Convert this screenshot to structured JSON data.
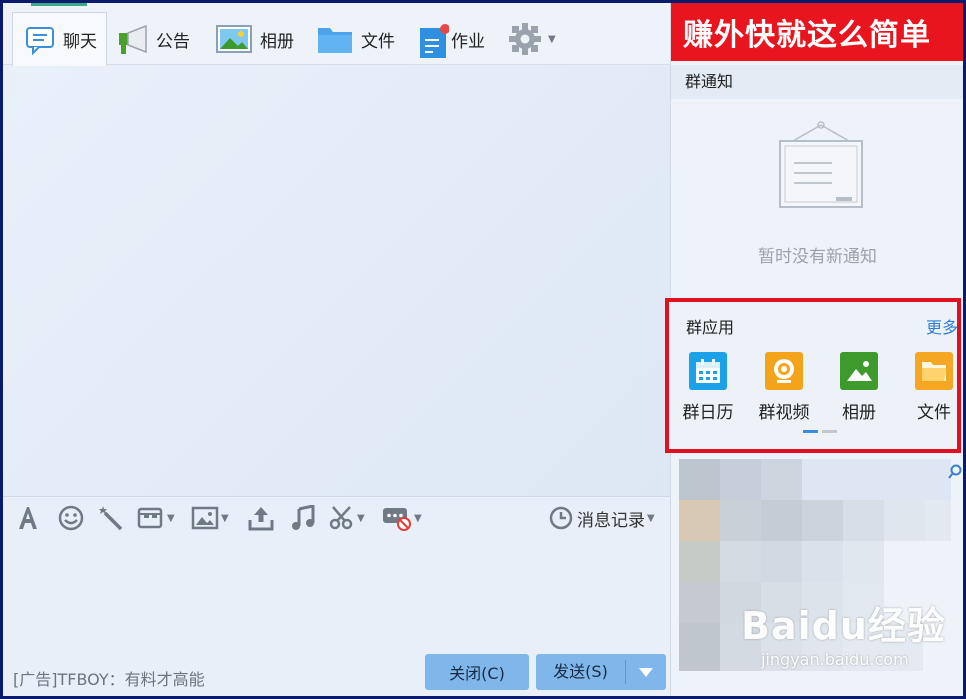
{
  "tabs": {
    "chat": "聊天",
    "notice": "公告",
    "album": "相册",
    "file": "文件",
    "homework": "作业"
  },
  "toolbar": {
    "history_label": "消息记录"
  },
  "footer": {
    "ad_text": "[广告]TFBOY：有料才高能",
    "close_label": "关闭(C)",
    "send_label": "发送(S)"
  },
  "right_panel": {
    "banner_text": "赚外快就这么简单",
    "notice_title": "群通知",
    "no_notice_text": "暂时没有新通知",
    "apps_title": "群应用",
    "apps_more": "更多",
    "apps": [
      {
        "label": "群日历",
        "icon": "calendar-icon",
        "color": "#1ba1e8"
      },
      {
        "label": "群视频",
        "icon": "video-icon",
        "color": "#f3a41b"
      },
      {
        "label": "相册",
        "icon": "album-icon",
        "color": "#3f9a2e"
      },
      {
        "label": "文件",
        "icon": "folder-icon",
        "color": "#f5a623"
      }
    ]
  },
  "watermark": {
    "main": "Baidu经验",
    "sub": "jingyan.baidu.com"
  },
  "colors": {
    "accent": "#7fb7ea",
    "banner": "#e8151f",
    "highlight_border": "#e01020",
    "link": "#2e7fd6"
  }
}
